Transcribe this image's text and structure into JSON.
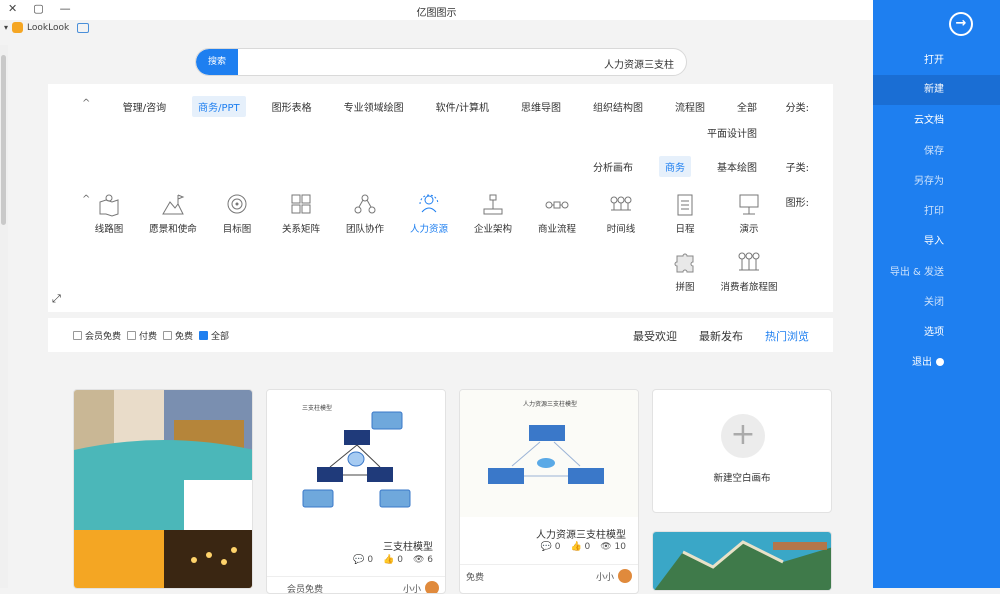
{
  "window": {
    "title": "亿图图示",
    "controls": [
      "✕",
      "▢",
      "—"
    ]
  },
  "brand": {
    "name": "LookLook"
  },
  "search": {
    "button": "搜索",
    "value": "人力资源三支柱"
  },
  "filters": {
    "category": {
      "label": "分类:",
      "items": [
        "全部",
        "流程图",
        "组织结构图",
        "思维导图",
        "软件/计算机",
        "专业领域绘图",
        "图形表格",
        "商务/PPT",
        "管理/咨询",
        "平面设计图"
      ],
      "active": "商务/PPT"
    },
    "sub": {
      "label": "子类:",
      "items": [
        "基本绘图",
        "商务",
        "分析画布"
      ],
      "active": "商务"
    },
    "figure": {
      "label": "图形:",
      "items": [
        {
          "label": "演示",
          "icon": "presentation-icon"
        },
        {
          "label": "日程",
          "icon": "schedule-icon"
        },
        {
          "label": "时间线",
          "icon": "timeline-icon"
        },
        {
          "label": "商业流程",
          "icon": "business-process-icon"
        },
        {
          "label": "企业架构",
          "icon": "enterprise-architecture-icon"
        },
        {
          "label": "人力资源",
          "icon": "human-resources-icon"
        },
        {
          "label": "团队协作",
          "icon": "team-collaboration-icon"
        },
        {
          "label": "关系矩阵",
          "icon": "relation-matrix-icon"
        },
        {
          "label": "目标图",
          "icon": "target-icon"
        },
        {
          "label": "愿景和使命",
          "icon": "vision-mission-icon"
        },
        {
          "label": "线路图",
          "icon": "roadmap-icon"
        },
        {
          "label": "消费者旅程图",
          "icon": "customer-journey-icon"
        },
        {
          "label": "拼图",
          "icon": "puzzle-icon"
        }
      ],
      "active": "人力资源"
    }
  },
  "tabs": {
    "items": [
      "热门浏览",
      "最新发布",
      "最受欢迎"
    ],
    "active": "热门浏览"
  },
  "price_filter": [
    {
      "label": "全部",
      "checked": true
    },
    {
      "label": "免费",
      "checked": false
    },
    {
      "label": "付费",
      "checked": false
    },
    {
      "label": "会员免费",
      "checked": false
    }
  ],
  "cards": {
    "new_blank": {
      "label": "新建空白画布"
    },
    "template1": {
      "title": "人力资源三支柱模型",
      "header": "人力资源三支柱模型",
      "views": "10",
      "likes": "0",
      "comments": "0",
      "author": "小小",
      "price": "免费"
    },
    "template2": {
      "title": "三支柱模型",
      "header": "三支柱模型",
      "views": "6",
      "likes": "0",
      "comments": "0",
      "author": "小小",
      "price": "会员免费"
    }
  },
  "sidebar": {
    "back_icon": "arrow-right-circle-icon",
    "items": [
      "打开",
      "新建",
      "云文档",
      "保存",
      "另存为",
      "打印",
      "导入",
      "导出 & 发送",
      "关闭",
      "选项",
      "退出"
    ],
    "selected": "新建"
  },
  "colors": {
    "accent": "#1e7ff0",
    "sidebar": "#1e7ff0",
    "teal": "#4bb7b9",
    "orange": "#f4a623"
  }
}
